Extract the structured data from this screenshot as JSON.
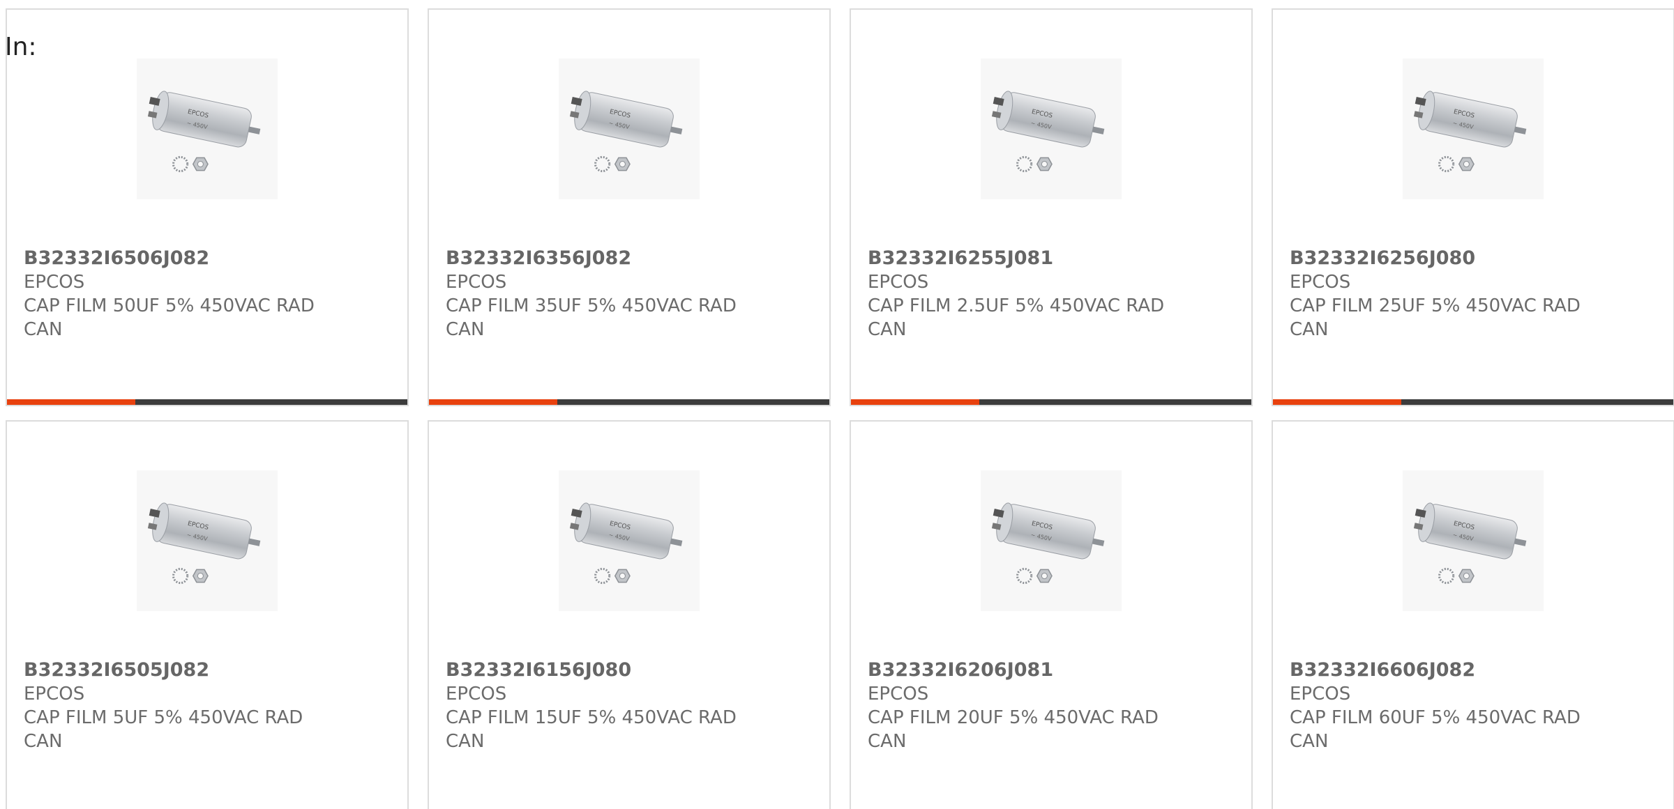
{
  "header": {
    "in_label": "In:"
  },
  "colors": {
    "accent": "#e8410e",
    "track": "#3c3c3c",
    "border": "#dcdcdc",
    "text": "#6b6b6b"
  },
  "products": [
    {
      "part": "B32332I6506J082",
      "brand": "EPCOS",
      "desc": "CAP FILM 50UF 5% 450VAC RAD CAN",
      "image_icon": "capacitor-image",
      "progress": 0.32
    },
    {
      "part": "B32332I6356J082",
      "brand": "EPCOS",
      "desc": "CAP FILM 35UF 5% 450VAC RAD CAN",
      "image_icon": "capacitor-image",
      "progress": 0.32
    },
    {
      "part": "B32332I6255J081",
      "brand": "EPCOS",
      "desc": "CAP FILM 2.5UF 5% 450VAC RAD CAN",
      "image_icon": "capacitor-image",
      "progress": 0.32
    },
    {
      "part": "B32332I6256J080",
      "brand": "EPCOS",
      "desc": "CAP FILM 25UF 5% 450VAC RAD CAN",
      "image_icon": "capacitor-image",
      "progress": 0.32
    },
    {
      "part": "B32332I6505J082",
      "brand": "EPCOS",
      "desc": "CAP FILM 5UF 5% 450VAC RAD CAN",
      "image_icon": "capacitor-image"
    },
    {
      "part": "B32332I6156J080",
      "brand": "EPCOS",
      "desc": "CAP FILM 15UF 5% 450VAC RAD CAN",
      "image_icon": "capacitor-image"
    },
    {
      "part": "B32332I6206J081",
      "brand": "EPCOS",
      "desc": "CAP FILM 20UF 5% 450VAC RAD CAN",
      "image_icon": "capacitor-image"
    },
    {
      "part": "B32332I6606J082",
      "brand": "EPCOS",
      "desc": "CAP FILM 60UF 5% 450VAC RAD CAN",
      "image_icon": "capacitor-image"
    }
  ]
}
